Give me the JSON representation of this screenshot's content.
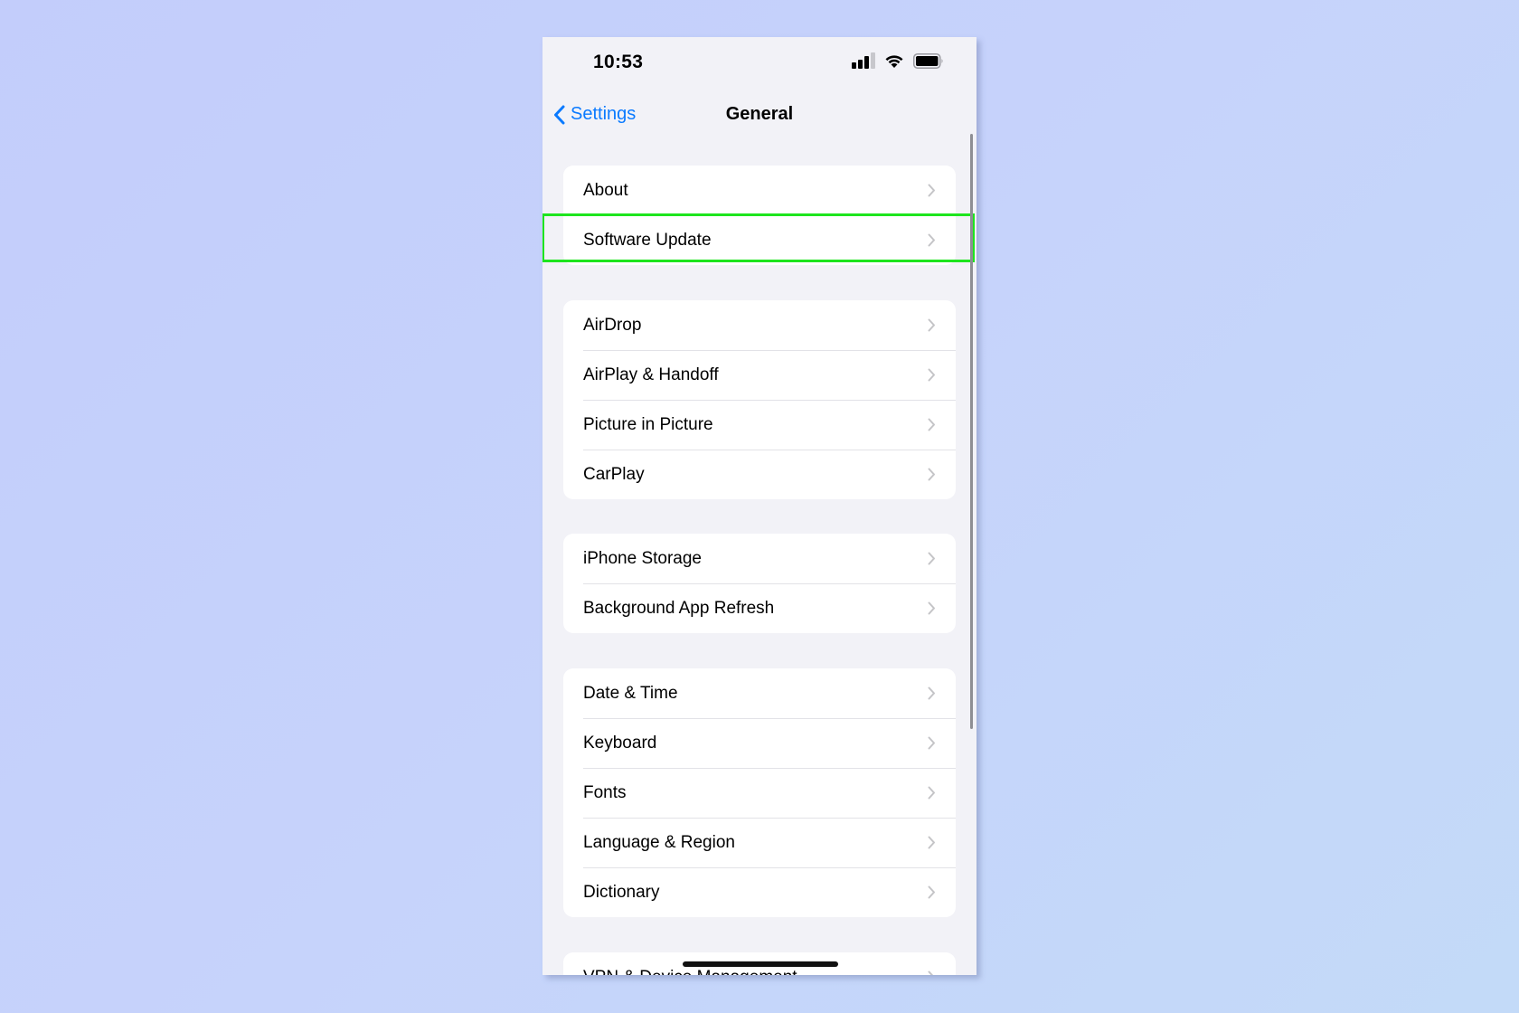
{
  "status_bar": {
    "time": "10:53",
    "icons": [
      "signal-icon",
      "wifi-icon",
      "battery-icon"
    ]
  },
  "nav": {
    "back_label": "Settings",
    "title": "General"
  },
  "groups": [
    {
      "items": [
        {
          "label": "About"
        },
        {
          "label": "Software Update",
          "highlighted": true
        }
      ]
    },
    {
      "items": [
        {
          "label": "AirDrop"
        },
        {
          "label": "AirPlay & Handoff"
        },
        {
          "label": "Picture in Picture"
        },
        {
          "label": "CarPlay"
        }
      ]
    },
    {
      "items": [
        {
          "label": "iPhone Storage"
        },
        {
          "label": "Background App Refresh"
        }
      ]
    },
    {
      "items": [
        {
          "label": "Date & Time"
        },
        {
          "label": "Keyboard"
        },
        {
          "label": "Fonts"
        },
        {
          "label": "Language & Region"
        },
        {
          "label": "Dictionary"
        }
      ]
    },
    {
      "items": [
        {
          "label": "VPN & Device Management"
        }
      ]
    }
  ],
  "colors": {
    "accent": "#0a7aff",
    "highlight_box": "#1ee51e",
    "background": "#c5d1fb",
    "screen_background": "#f2f2f7"
  }
}
